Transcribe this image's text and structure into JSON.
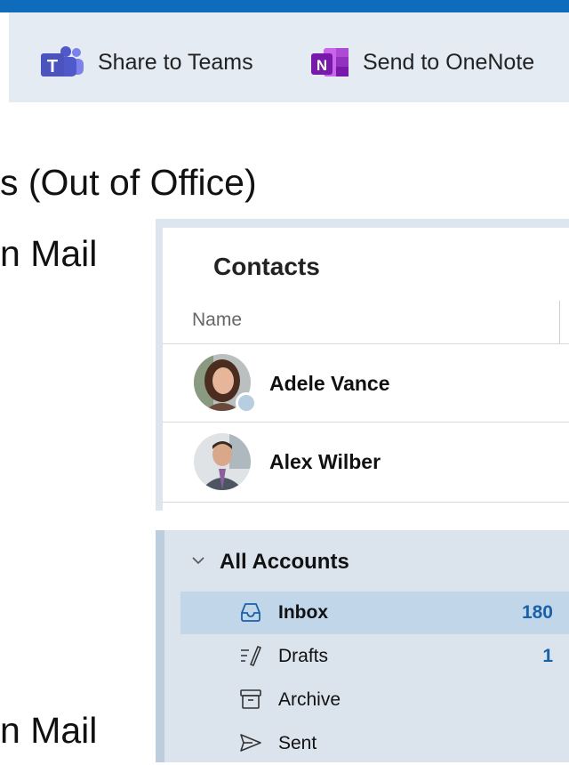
{
  "ribbon": {
    "share_teams_label": "Share to Teams",
    "send_onenote_label": "Send to OneNote",
    "teams_icon_letter": "T",
    "onenote_icon_letter": "N"
  },
  "slide": {
    "line1": "s (Out of Office)",
    "line2": "n Mail",
    "line3": "n Mail"
  },
  "contacts": {
    "title": "Contacts",
    "column_header": "Name",
    "rows": [
      {
        "name": "Adele Vance",
        "presence": "away"
      },
      {
        "name": "Alex Wilber"
      }
    ]
  },
  "mail": {
    "accounts_label": "All Accounts",
    "folders": [
      {
        "name": "Inbox",
        "count": "180",
        "icon": "inbox-icon",
        "selected": true
      },
      {
        "name": "Drafts",
        "count": "1",
        "icon": "drafts-icon"
      },
      {
        "name": "Archive",
        "count": "",
        "icon": "archive-icon"
      },
      {
        "name": "Sent",
        "count": "",
        "icon": "sent-icon"
      }
    ]
  },
  "colors": {
    "accent": "#0f6cbd",
    "ribbon_bg": "#e4ebf3",
    "selected_folder": "#c2d6ea",
    "count_text": "#1a62a8"
  }
}
